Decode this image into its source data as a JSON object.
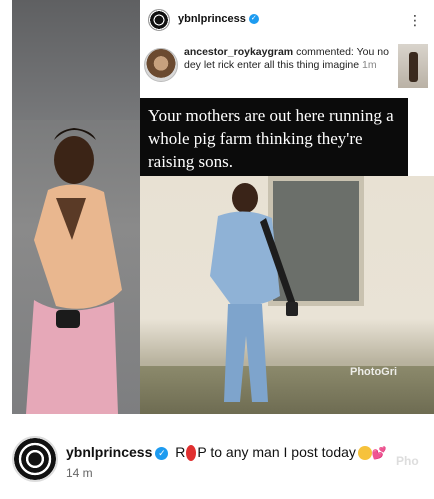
{
  "post": {
    "username": "ybnlprincess",
    "more_icon": "more-vertical-icon"
  },
  "comment": {
    "author": "ancestor_roykaygram",
    "action": "commented:",
    "text": "You no dey let rick enter all this thing imagine",
    "time": "1m"
  },
  "meme_caption": "Your mothers are out here running a whole pig farm thinking they're raising sons.",
  "watermark": "PhotoGri",
  "footer": {
    "username": "ybnlprincess",
    "caption_r": "R",
    "caption_p": "P to any man I post today",
    "time": "14 m",
    "watermark": "Pho"
  },
  "colors": {
    "verified": "#1d9bf0",
    "redact": "#e03030"
  }
}
